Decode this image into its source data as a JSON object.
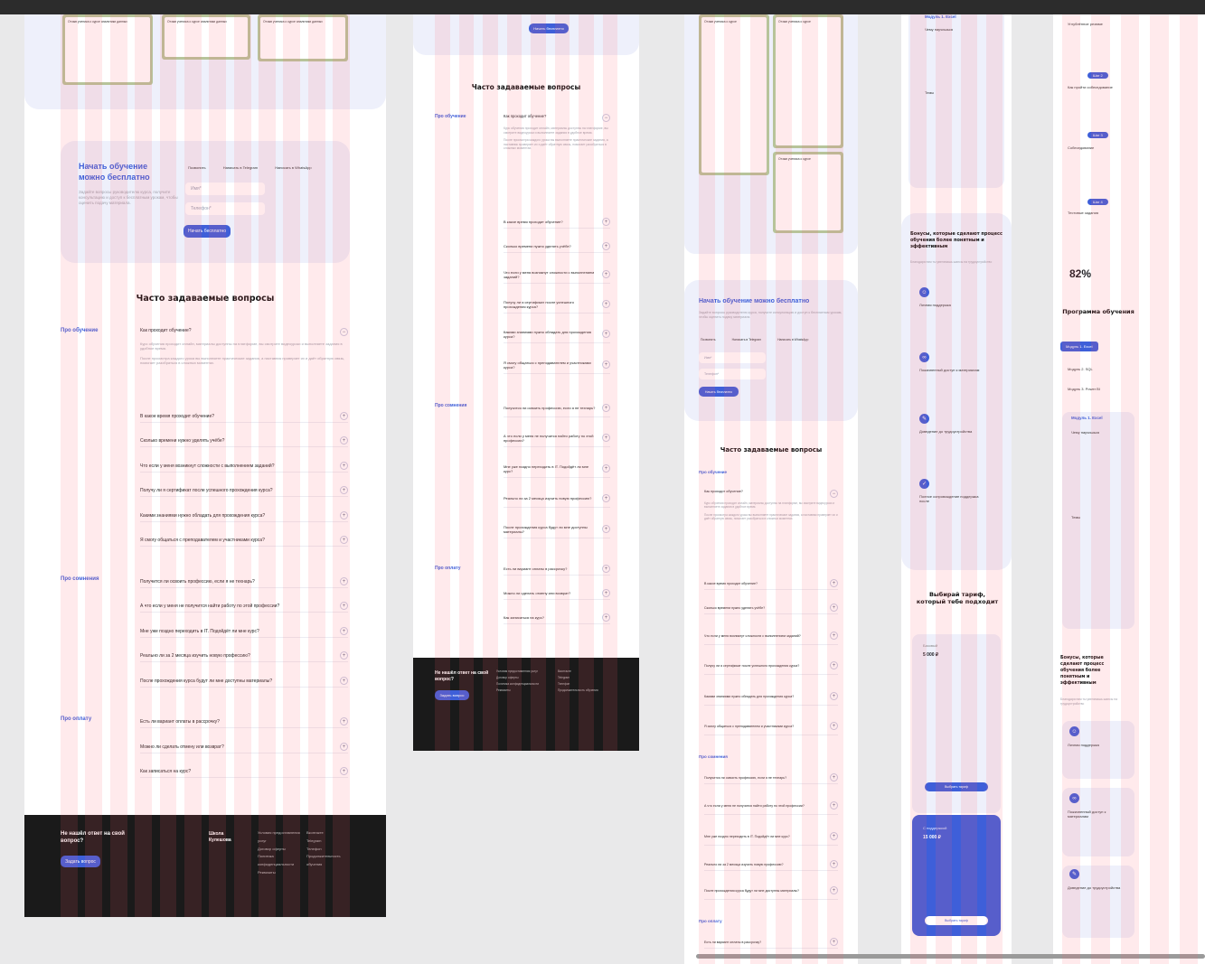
{
  "faq_title": "Часто задаваемые вопросы",
  "sections": {
    "learning": "Про обучение",
    "doubts": "Про сомнения",
    "payment": "Про оплату"
  },
  "faq_open": {
    "q": "Как проходит обучение?",
    "a1": "Курс обучения проходит онлайн, материалы доступны на платформе, вы смотрите видеоуроки и выполняете задания в удобное время.",
    "a2": "После просмотра каждого урока вы выполняете практические задания, а наставник проверяет их и даёт обратную связь, помогает разобраться в сложных моментах."
  },
  "faq_learning": [
    "В какое время проходит обучение?",
    "Сколько времени нужно уделять учёбе?",
    "Что если у меня возникнут сложности с выполнением заданий?",
    "Получу ли я сертификат после успешного прохождения курса?",
    "Какими знаниями нужно обладать для прохождения курса?",
    "Я смогу общаться с преподавателем и участниками курса?"
  ],
  "faq_doubts": [
    "Получится ли освоить профессию, если я не технарь?",
    "А что если у меня не получится найти работу по этой профессии?",
    "Мне уже поздно переходить в IT. Подойдёт ли мне курс?",
    "Реально ли за 2 месяца изучить новую профессию?",
    "После прохождения курса будут ли мне доступны материалы?"
  ],
  "faq_payment": [
    "Есть ли вариант оплаты в рассрочку?",
    "Можно ли сделать отмену или возврат?",
    "Как записаться на курс?"
  ],
  "start": {
    "title": "Начать обучение можно бесплатно",
    "desc": "Задайте вопросы руководителю курса, получите консультацию и доступ к бесплатным урокам, чтобы оценить подачу материала.",
    "tabs": [
      "Позвонить",
      "Написать в Telegram",
      "Написать в WhatsApp"
    ],
    "name_ph": "Имя*",
    "phone_ph": "Телефон*",
    "button": "Начать бесплатно"
  },
  "footer": {
    "title": "Не нашёл ответ на свой вопрос?",
    "button": "Задать вопрос",
    "brand": "Школа Кулешова",
    "links": [
      "Условия предоставления услуг",
      "Договор оферты",
      "Политика конфиденциальности",
      "Реквизиты",
      "Вконтакте",
      "Telegram",
      "Телефон",
      "Продолжительность обучения"
    ]
  },
  "bonus": {
    "title": "Бонусы, которые сделают процесс обучения более понятным и эффективным",
    "subtitle": "Благодаря ним ты увеличишь шансы на трудоустройство",
    "items": [
      "Личная поддержка",
      "Пожизненный доступ к материалам",
      "Доведение до трудоустройства",
      "Полное сопровождение поддержка после"
    ]
  },
  "tariff": {
    "title": "Выбирай тариф, который тебе подходит",
    "basic_name": "Базовый",
    "basic_price": "5 000 ₽",
    "basic_btn": "Выбрать тариф",
    "pro_name": "С поддержкой",
    "pro_price": "15 000 ₽",
    "pro_btn": "Выбрать тариф"
  },
  "program": {
    "title": "Программа обучения",
    "stat": "82%",
    "modules": [
      "Модуль 1. Excel",
      "Модуль 2. SQL",
      "Модуль 3. Power BI"
    ],
    "module_title": "Модуль 1. Excel",
    "learn_title": "Чему научишься",
    "topics_title": "Темы",
    "stages": [
      "Шаг 1",
      "Шаг 2",
      "Шаг 3",
      "Шаг 4"
    ],
    "stage_titles": [
      "Углублённое резюме",
      "Как пройти собеседование",
      "Собеседование",
      "Тестовые задания"
    ]
  },
  "colors": {
    "accent": "#3e5fd9",
    "footer": "#1a1a1a",
    "overlay": "#ff5a6e"
  }
}
